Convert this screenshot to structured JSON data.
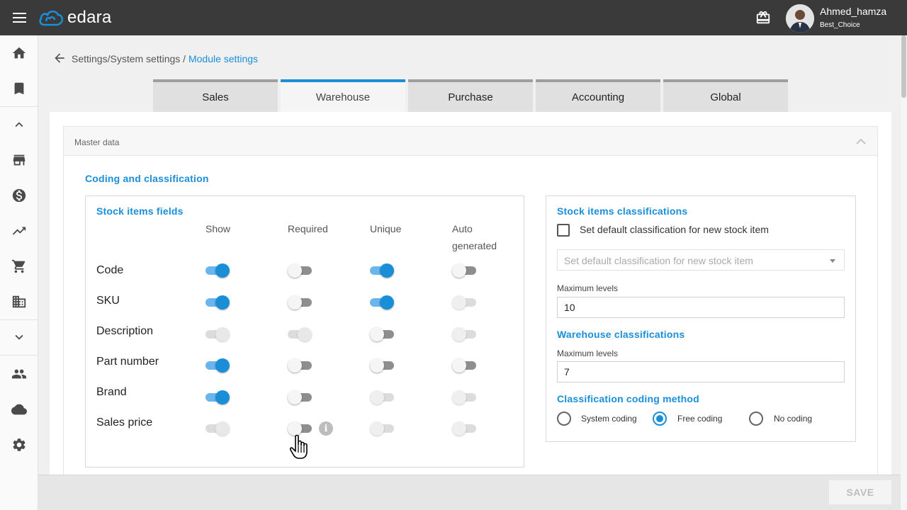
{
  "app": {
    "brand": "edara",
    "user_name": "Ahmed_hamza",
    "user_company": "Best_Choice"
  },
  "breadcrumb": {
    "path": "Settings/System settings / ",
    "current": "Module settings"
  },
  "tabs": [
    {
      "label": "Sales",
      "active": false
    },
    {
      "label": "Warehouse",
      "active": true
    },
    {
      "label": "Purchase",
      "active": false
    },
    {
      "label": "Accounting",
      "active": false
    },
    {
      "label": "Global",
      "active": false
    }
  ],
  "panel": {
    "title": "Master data",
    "section_title": "Coding and classification"
  },
  "stock_fields": {
    "title": "Stock items fields",
    "columns": [
      "Show",
      "Required",
      "Unique",
      "Auto generated"
    ],
    "rows": [
      {
        "label": "Code",
        "states": [
          "on",
          "off",
          "on",
          "off"
        ]
      },
      {
        "label": "SKU",
        "states": [
          "on",
          "off",
          "on",
          "disabled"
        ]
      },
      {
        "label": "Description",
        "states": [
          "disabled-on",
          "disabled-on",
          "off",
          "disabled"
        ]
      },
      {
        "label": "Part number",
        "states": [
          "on",
          "off",
          "off",
          "off"
        ]
      },
      {
        "label": "Brand",
        "states": [
          "on",
          "off",
          "disabled",
          "disabled"
        ]
      },
      {
        "label": "Sales price",
        "states": [
          "disabled-on",
          "off",
          "disabled",
          "disabled"
        ]
      }
    ]
  },
  "classifications": {
    "stock_title": "Stock items classifications",
    "default_checkbox_label": "Set default classification for new stock item",
    "default_checkbox_checked": false,
    "default_select_placeholder": "Set default classification for new stock item",
    "stock_max_levels_label": "Maximum levels",
    "stock_max_levels_value": "10",
    "warehouse_title": "Warehouse classifications",
    "warehouse_max_levels_label": "Maximum levels",
    "warehouse_max_levels_value": "7",
    "coding_method_title": "Classification coding method",
    "coding_options": [
      {
        "label": "System coding",
        "checked": false
      },
      {
        "label": "Free coding",
        "checked": true
      },
      {
        "label": "No coding",
        "checked": false
      }
    ]
  },
  "footer": {
    "save_label": "SAVE"
  },
  "colors": {
    "accent": "#1a8fd8",
    "topbar": "#3a3a3a"
  },
  "icons": [
    "menu-icon",
    "cloud-logo-icon",
    "gift-icon",
    "home-icon",
    "bookmark-icon",
    "chevron-up-icon",
    "store-icon",
    "dollar-icon",
    "trending-up-icon",
    "cart-icon",
    "building-icon",
    "chevron-down-icon",
    "people-icon",
    "cloud-icon",
    "gear-icon",
    "arrow-back-icon",
    "info-icon",
    "hand-cursor-icon"
  ]
}
